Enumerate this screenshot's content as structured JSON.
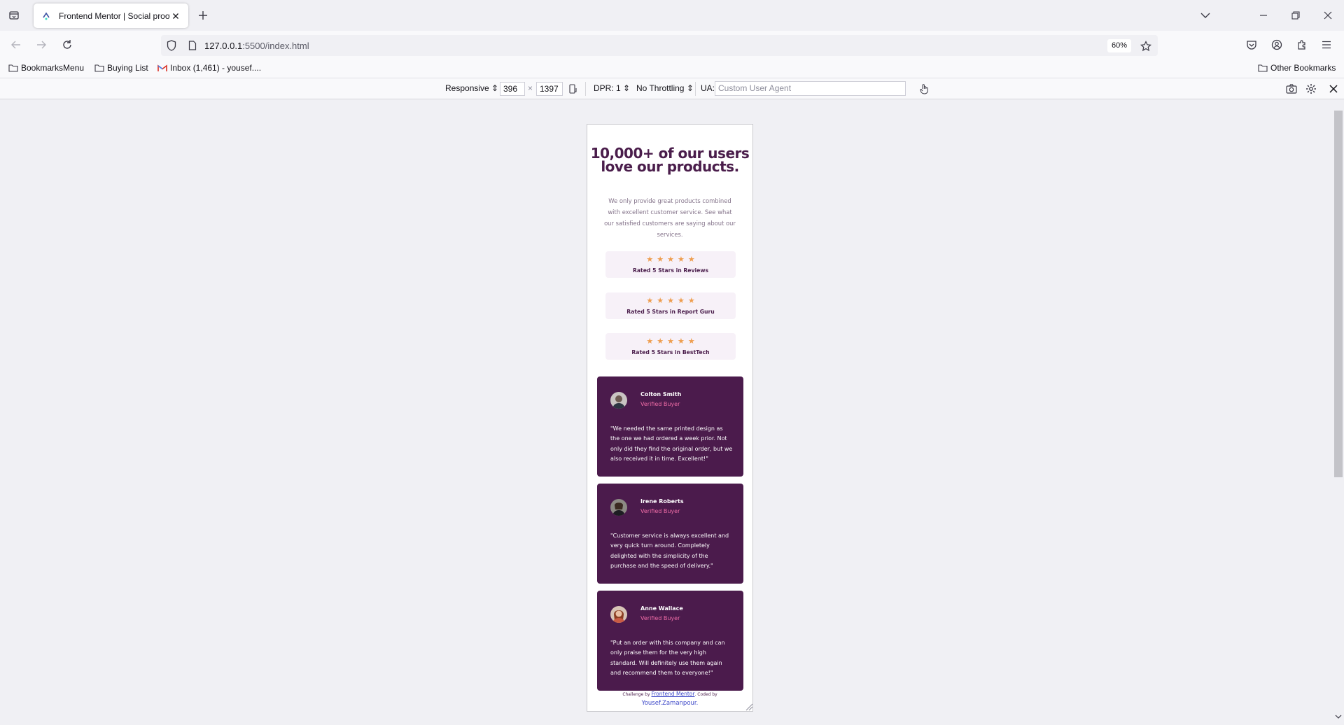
{
  "browser": {
    "tab_title": "Frontend Mentor | Social proof",
    "url_host": "127.0.0.1",
    "url_path": ":5500/index.html",
    "zoom": "60%",
    "bookmarks": [
      "BookmarksMenu",
      "Buying List",
      "Inbox (1,461) - yousef...."
    ],
    "other_bookmarks": "Other Bookmarks"
  },
  "rdm": {
    "device": "Responsive",
    "width": "396",
    "times": "×",
    "height": "1397",
    "dpr": "DPR: 1",
    "throttling": "No Throttling",
    "ua_label": "UA:",
    "ua_placeholder": "Custom User Agent"
  },
  "page": {
    "title": "10,000+ of our users love our products.",
    "description": "We only provide great products combined with excellent customer service. See what our satisfied customers are saying about our services.",
    "stars_count": 5,
    "ratings": [
      "Rated 5 Stars in Reviews",
      "Rated 5 Stars in Report Guru",
      "Rated 5 Stars in BestTech"
    ],
    "reviews": [
      {
        "name": "Colton Smith",
        "role": "Verified Buyer",
        "quote": "\"We needed the same printed design as the one we had ordered a week prior. Not only did they find the original order, but we also received it in time. Excellent!\""
      },
      {
        "name": "Irene Roberts",
        "role": "Verified Buyer",
        "quote": "\"Customer service is always excellent and very quick turn around. Completely delighted with the simplicity of the purchase and the speed of delivery.\""
      },
      {
        "name": "Anne Wallace",
        "role": "Verified Buyer",
        "quote": "\"Put an order with this company and can only praise them for the very high standard. Will definitely use them again and recommend them to everyone!\""
      }
    ],
    "footer": {
      "prefix": "Challenge by",
      "link": "Frontend Mentor",
      "middle": ". Coded by",
      "author": "Yousef.Zamanpour."
    }
  },
  "colors": {
    "brand_purple": "#4a1d4b",
    "card_purple": "#4b1b4c",
    "star_orange": "#ee9d4e",
    "pink": "#ee6ba6"
  }
}
